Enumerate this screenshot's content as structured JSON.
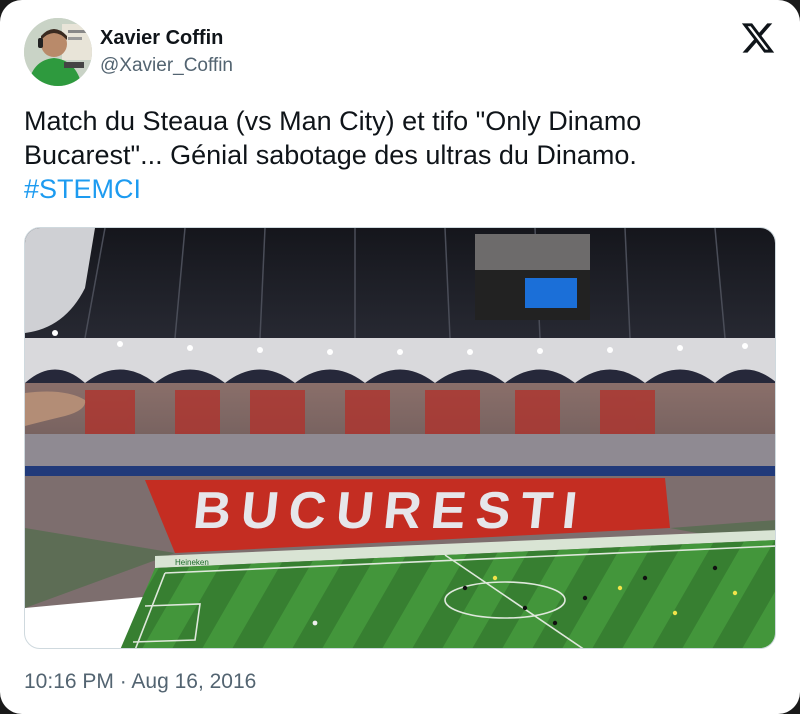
{
  "user": {
    "name": "Xavier Coffin",
    "handle": "@Xavier_Coffin"
  },
  "tweet": {
    "text": "Match du Steaua (vs Man City) et tifo \"Only Dinamo Bucarest\"... Génial sabotage des ultras du Dinamo.",
    "hashtag": "#STEMCI"
  },
  "media": {
    "tifo_text": "BUCURESTI",
    "board_text": "Heineken"
  },
  "meta": {
    "timestamp": "10:16 PM · Aug 16, 2016"
  },
  "icons": {
    "logo": "x-logo-icon",
    "avatar": "user-avatar"
  },
  "colors": {
    "name": "#0f1419",
    "handle": "#536471",
    "hashtag": "#1d9bf0",
    "pitch": "#3f8f3a"
  }
}
